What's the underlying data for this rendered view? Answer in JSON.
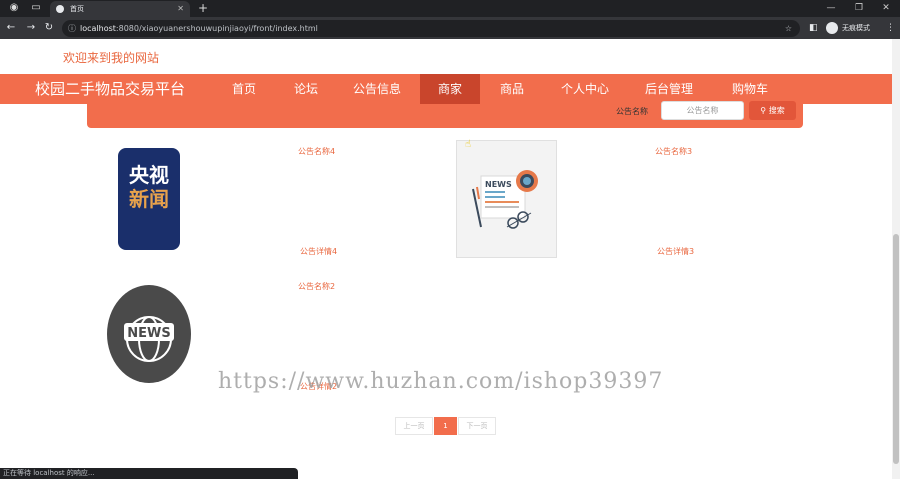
{
  "browser": {
    "tab_title": "首页",
    "new_tab": "+",
    "url_host": "localhost",
    "url_rest": ":8080/xiaoyuanershouwupinjiaoyi/front/index.html",
    "incognito_label": "无痕模式",
    "status_text": "正在等待 localhost 的响应..."
  },
  "site": {
    "welcome": "欢迎来到我的网站",
    "brand": "校园二手物品交易平台",
    "nav": [
      "首页",
      "论坛",
      "公告信息",
      "商家",
      "商品",
      "个人中心",
      "后台管理",
      "购物车"
    ],
    "active_nav": "商家"
  },
  "search": {
    "label": "公告名称",
    "placeholder": "公告名称",
    "button": "搜索"
  },
  "notices": [
    {
      "title": "公告名称4",
      "detail": "公告详情4",
      "image_text": [
        "央视",
        "新闻"
      ]
    },
    {
      "title": "公告名称3",
      "detail": "公告详情3",
      "image_text": "NEWS"
    },
    {
      "title": "公告名称2",
      "detail": "公告详情2",
      "image_text": "NEWS"
    }
  ],
  "pagination": {
    "prev": "上一页",
    "current": "1",
    "next": "下一页"
  },
  "watermark": "https://www.huzhan.com/ishop39397",
  "colors": {
    "primary": "#f26d4c",
    "active_nav": "#c9452c",
    "accent_text": "#e9673f"
  }
}
